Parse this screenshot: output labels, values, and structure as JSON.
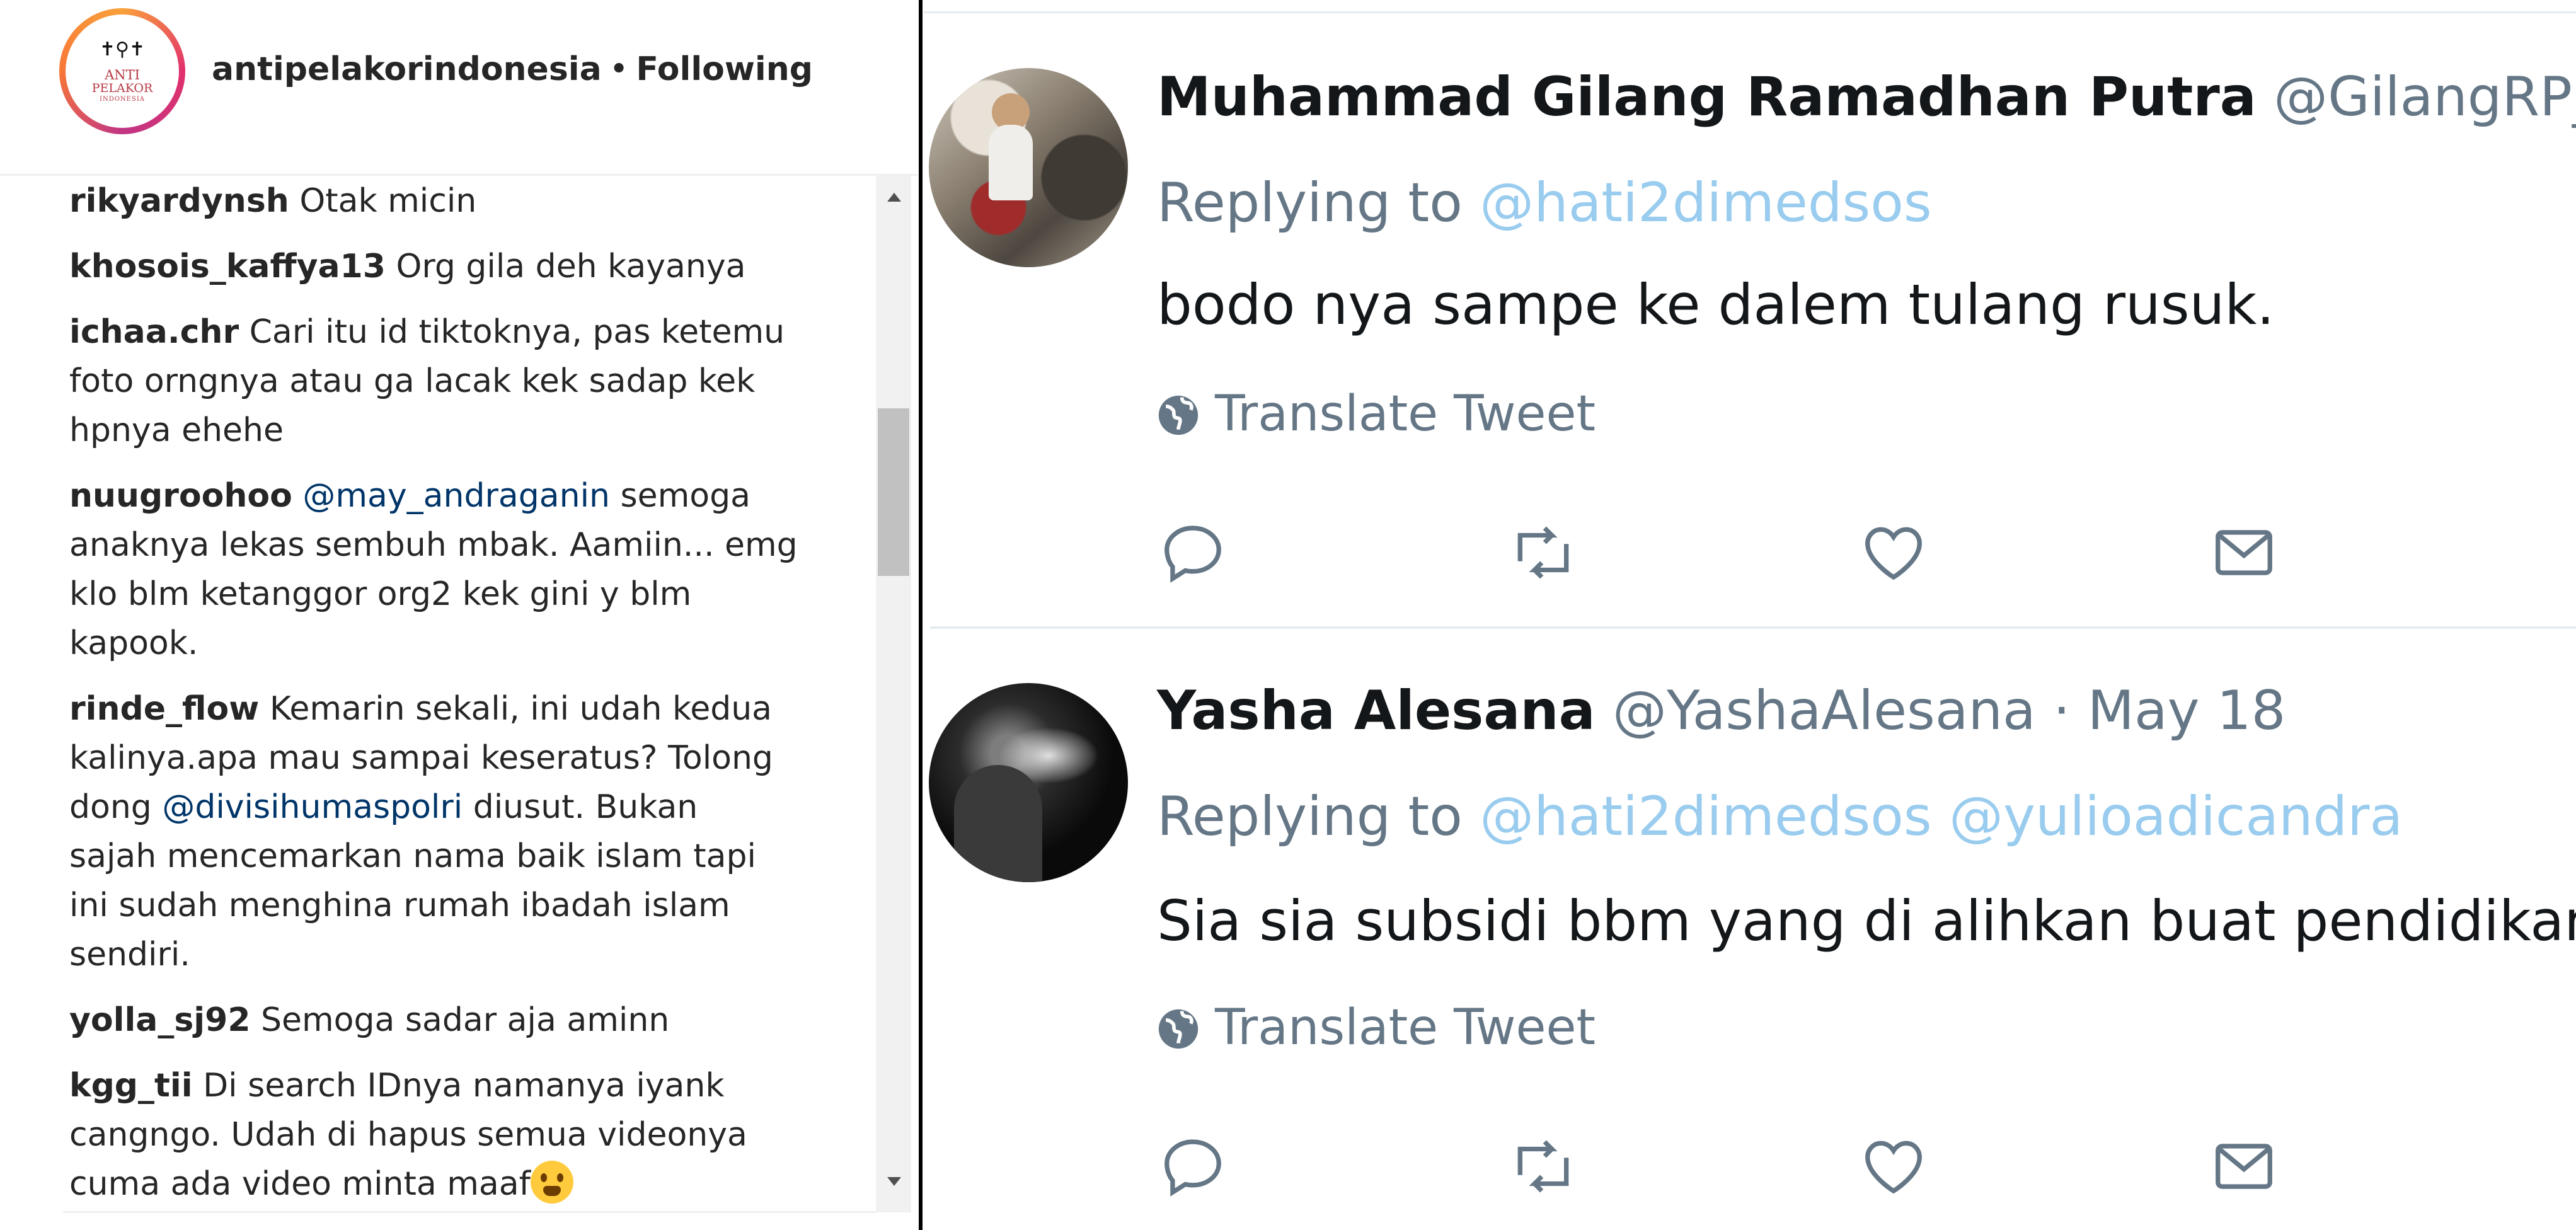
{
  "instagram": {
    "account": {
      "avatar_text": [
        "ANTI",
        "PELAKOR",
        "INDONESIA"
      ],
      "username": "antipelakorindonesia",
      "separator": "•",
      "follow_status": "Following"
    },
    "comments": [
      {
        "user": "rikyardynsh",
        "lines": [
          [
            {
              "t": "Otak micin"
            }
          ]
        ]
      },
      {
        "user": "khosois_kaffya13",
        "lines": [
          [
            {
              "t": "Org gila deh kayanya"
            }
          ]
        ]
      },
      {
        "user": "ichaa.chr",
        "lines": [
          [
            {
              "t": "Cari itu id tiktoknya, pas ketemu"
            }
          ],
          [
            {
              "t": "foto orngnya atau ga lacak kek sadap kek"
            }
          ],
          [
            {
              "t": "hpnya ehehe"
            }
          ]
        ]
      },
      {
        "user": "nuugroohoo",
        "lines": [
          [
            {
              "t": "@may_andraganin",
              "mention": true
            },
            {
              "t": " semoga"
            }
          ],
          [
            {
              "t": "anaknya lekas sembuh mbak. Aamiin... emg"
            }
          ],
          [
            {
              "t": "klo blm ketanggor org2 kek gini y blm"
            }
          ],
          [
            {
              "t": "kapook."
            }
          ]
        ]
      },
      {
        "user": "rinde_flow",
        "lines": [
          [
            {
              "t": "Kemarin sekali, ini udah kedua"
            }
          ],
          [
            {
              "t": "kalinya.apa mau sampai keseratus? Tolong"
            }
          ],
          [
            {
              "t": "dong "
            },
            {
              "t": "@divisihumaspolri",
              "mention": true
            },
            {
              "t": " diusut. Bukan"
            }
          ],
          [
            {
              "t": "sajah mencemarkan nama baik islam tapi"
            }
          ],
          [
            {
              "t": "ini sudah menghina rumah ibadah islam"
            }
          ],
          [
            {
              "t": "sendiri."
            }
          ]
        ]
      },
      {
        "user": "yolla_sj92",
        "lines": [
          [
            {
              "t": "Semoga sadar aja aminn"
            }
          ]
        ]
      },
      {
        "user": "kgg_tii",
        "lines": [
          [
            {
              "t": "Di search IDnya namanya iyank"
            }
          ],
          [
            {
              "t": "cangngo. Udah di hapus semua videonya"
            }
          ],
          [
            {
              "t": "cuma ada video minta maaf"
            },
            {
              "emoji": "face-screaming-emoji"
            }
          ]
        ]
      }
    ]
  },
  "twitter": {
    "tweets": [
      {
        "name": "Muhammad Gilang Ramadhan Putra",
        "handle": "@GilangRP_",
        "date_suffix": " ·",
        "replying_label": "Replying to",
        "replying_to": [
          "@hati2dimedsos"
        ],
        "text": "bodo nya sampe ke dalem tulang rusuk.",
        "translate_label": "Translate Tweet",
        "actions": [
          "reply-icon",
          "retweet-icon",
          "like-icon",
          "direct-message-icon"
        ]
      },
      {
        "name": "Yasha Alesana",
        "handle": "@YashaAlesana",
        "date_suffix": " · May 18",
        "replying_label": "Replying to",
        "replying_to": [
          "@hati2dimedsos",
          "@yulioadicandra"
        ],
        "text": "Sia sia subsidi bbm yang di alihkan buat pendidikan",
        "translate_label": "Translate Tweet",
        "actions": [
          "reply-icon",
          "retweet-icon",
          "like-icon",
          "direct-message-icon"
        ]
      }
    ],
    "colors": {
      "mention": "#99ccee",
      "secondary_text": "#657786",
      "primary_text": "#14171a",
      "divider": "#e6ecf0"
    }
  }
}
